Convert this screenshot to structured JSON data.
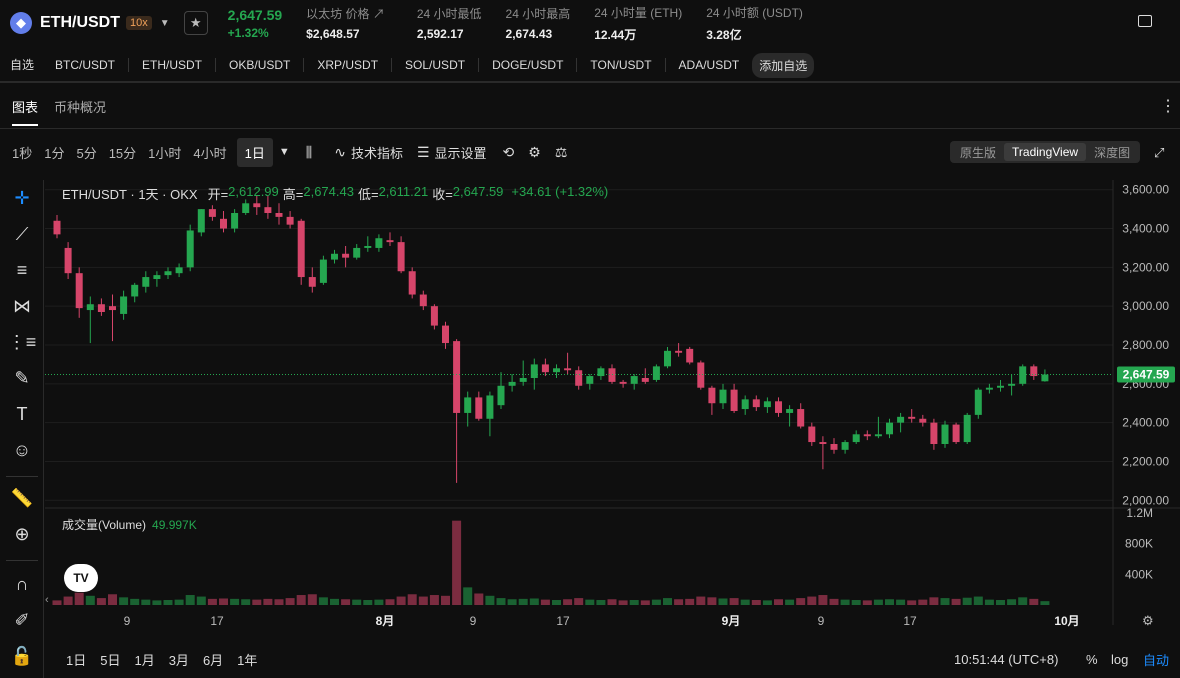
{
  "header": {
    "coin_icon": "eth-icon",
    "pair": "ETH/USDT",
    "leverage": "10x",
    "last_price": "2,647.59",
    "change_pct": "+1.32%",
    "stats": [
      {
        "label": "以太坊 价格 ↗",
        "value": "$2,648.57"
      },
      {
        "label": "24 小时最低",
        "value": "2,592.17"
      },
      {
        "label": "24 小时最高",
        "value": "2,674.43"
      },
      {
        "label": "24 小时量 (ETH)",
        "value": "12.44万"
      },
      {
        "label": "24 小时额 (USDT)",
        "value": "3.28亿"
      }
    ]
  },
  "watchlist": {
    "label": "自选",
    "items": [
      "BTC/USDT",
      "ETH/USDT",
      "OKB/USDT",
      "XRP/USDT",
      "SOL/USDT",
      "DOGE/USDT",
      "TON/USDT",
      "ADA/USDT"
    ],
    "add_label": "添加自选"
  },
  "tabs": [
    "图表",
    "币种概况"
  ],
  "toolbar": {
    "intervals": [
      "1秒",
      "1分",
      "5分",
      "15分",
      "1小时",
      "4小时"
    ],
    "selected_interval": "1日",
    "indicators_label": "技术指标",
    "display_label": "显示设置",
    "views": [
      "原生版",
      "TradingView",
      "深度图"
    ]
  },
  "legend": {
    "title": "ETH/USDT · 1天 · OKX",
    "open_label": "开=",
    "open": "2,612.99",
    "high_label": "高=",
    "high": "2,674.43",
    "low_label": "低=",
    "low": "2,611.21",
    "close_label": "收=",
    "close": "2,647.59",
    "change": "+34.61 (+1.32%)"
  },
  "volume_legend": {
    "label": "成交量(Volume)",
    "value": "49.997K"
  },
  "price_axis": [
    "3,600.00",
    "3,400.00",
    "3,200.00",
    "3,000.00",
    "2,800.00",
    "2,600.00",
    "2,400.00",
    "2,200.00",
    "2,000.00"
  ],
  "last_price_tag": "2,647.59",
  "volume_axis": [
    "1.2M",
    "800K",
    "400K"
  ],
  "time_axis": [
    "9",
    "17",
    "8月",
    "9",
    "17",
    "9月",
    "9",
    "17",
    "10月"
  ],
  "ranges": [
    "1日",
    "5日",
    "1月",
    "3月",
    "6月",
    "1年"
  ],
  "clock": "10:51:44 (UTC+8)",
  "pct_label": "%",
  "log_label": "log",
  "auto_label": "自动",
  "colors": {
    "up": "#25a750",
    "down": "#d6456a",
    "accent": "#1c8cff"
  },
  "chart_data": {
    "type": "candlestick",
    "title": "ETH/USDT · 1天 · OKX",
    "ylim": [
      1950,
      3650
    ],
    "volume_ylim": [
      0,
      1200000
    ],
    "candles": [
      {
        "o": 3440,
        "h": 3470,
        "l": 3350,
        "c": 3370,
        "v": 60000
      },
      {
        "o": 3300,
        "h": 3330,
        "l": 3140,
        "c": 3170,
        "v": 110000
      },
      {
        "o": 3170,
        "h": 3200,
        "l": 2940,
        "c": 2990,
        "v": 160000
      },
      {
        "o": 2980,
        "h": 3050,
        "l": 2810,
        "c": 3010,
        "v": 120000
      },
      {
        "o": 3010,
        "h": 3040,
        "l": 2950,
        "c": 2970,
        "v": 90000
      },
      {
        "o": 3000,
        "h": 3060,
        "l": 2820,
        "c": 2980,
        "v": 140000
      },
      {
        "o": 2960,
        "h": 3080,
        "l": 2930,
        "c": 3050,
        "v": 100000
      },
      {
        "o": 3050,
        "h": 3120,
        "l": 3020,
        "c": 3110,
        "v": 80000
      },
      {
        "o": 3100,
        "h": 3180,
        "l": 3070,
        "c": 3150,
        "v": 70000
      },
      {
        "o": 3140,
        "h": 3180,
        "l": 3100,
        "c": 3160,
        "v": 60000
      },
      {
        "o": 3160,
        "h": 3200,
        "l": 3140,
        "c": 3180,
        "v": 65000
      },
      {
        "o": 3170,
        "h": 3220,
        "l": 3150,
        "c": 3200,
        "v": 70000
      },
      {
        "o": 3200,
        "h": 3420,
        "l": 3180,
        "c": 3390,
        "v": 130000
      },
      {
        "o": 3380,
        "h": 3500,
        "l": 3360,
        "c": 3500,
        "v": 110000
      },
      {
        "o": 3500,
        "h": 3520,
        "l": 3440,
        "c": 3460,
        "v": 80000
      },
      {
        "o": 3450,
        "h": 3490,
        "l": 3380,
        "c": 3400,
        "v": 85000
      },
      {
        "o": 3400,
        "h": 3500,
        "l": 3380,
        "c": 3480,
        "v": 80000
      },
      {
        "o": 3480,
        "h": 3550,
        "l": 3470,
        "c": 3530,
        "v": 75000
      },
      {
        "o": 3530,
        "h": 3570,
        "l": 3470,
        "c": 3510,
        "v": 70000
      },
      {
        "o": 3510,
        "h": 3570,
        "l": 3450,
        "c": 3480,
        "v": 80000
      },
      {
        "o": 3480,
        "h": 3530,
        "l": 3420,
        "c": 3460,
        "v": 75000
      },
      {
        "o": 3460,
        "h": 3490,
        "l": 3400,
        "c": 3420,
        "v": 90000
      },
      {
        "o": 3440,
        "h": 3450,
        "l": 3110,
        "c": 3150,
        "v": 130000
      },
      {
        "o": 3150,
        "h": 3200,
        "l": 3070,
        "c": 3100,
        "v": 140000
      },
      {
        "o": 3120,
        "h": 3260,
        "l": 3110,
        "c": 3240,
        "v": 100000
      },
      {
        "o": 3240,
        "h": 3290,
        "l": 3220,
        "c": 3270,
        "v": 80000
      },
      {
        "o": 3270,
        "h": 3310,
        "l": 3200,
        "c": 3250,
        "v": 75000
      },
      {
        "o": 3250,
        "h": 3320,
        "l": 3240,
        "c": 3300,
        "v": 70000
      },
      {
        "o": 3300,
        "h": 3360,
        "l": 3280,
        "c": 3310,
        "v": 65000
      },
      {
        "o": 3300,
        "h": 3370,
        "l": 3280,
        "c": 3350,
        "v": 70000
      },
      {
        "o": 3340,
        "h": 3380,
        "l": 3310,
        "c": 3330,
        "v": 75000
      },
      {
        "o": 3330,
        "h": 3360,
        "l": 3170,
        "c": 3180,
        "v": 110000
      },
      {
        "o": 3180,
        "h": 3200,
        "l": 3040,
        "c": 3060,
        "v": 140000
      },
      {
        "o": 3060,
        "h": 3080,
        "l": 2980,
        "c": 3000,
        "v": 110000
      },
      {
        "o": 3000,
        "h": 3010,
        "l": 2880,
        "c": 2900,
        "v": 130000
      },
      {
        "o": 2900,
        "h": 2920,
        "l": 2780,
        "c": 2810,
        "v": 120000
      },
      {
        "o": 2820,
        "h": 2830,
        "l": 2090,
        "c": 2450,
        "v": 1100000
      },
      {
        "o": 2450,
        "h": 2560,
        "l": 2380,
        "c": 2530,
        "v": 230000
      },
      {
        "o": 2530,
        "h": 2560,
        "l": 2410,
        "c": 2420,
        "v": 150000
      },
      {
        "o": 2420,
        "h": 2560,
        "l": 2330,
        "c": 2540,
        "v": 120000
      },
      {
        "o": 2490,
        "h": 2660,
        "l": 2470,
        "c": 2590,
        "v": 90000
      },
      {
        "o": 2590,
        "h": 2650,
        "l": 2560,
        "c": 2610,
        "v": 75000
      },
      {
        "o": 2610,
        "h": 2720,
        "l": 2590,
        "c": 2630,
        "v": 80000
      },
      {
        "o": 2630,
        "h": 2730,
        "l": 2570,
        "c": 2700,
        "v": 85000
      },
      {
        "o": 2700,
        "h": 2730,
        "l": 2640,
        "c": 2660,
        "v": 70000
      },
      {
        "o": 2660,
        "h": 2700,
        "l": 2630,
        "c": 2680,
        "v": 65000
      },
      {
        "o": 2680,
        "h": 2760,
        "l": 2650,
        "c": 2670,
        "v": 75000
      },
      {
        "o": 2670,
        "h": 2690,
        "l": 2570,
        "c": 2590,
        "v": 90000
      },
      {
        "o": 2600,
        "h": 2650,
        "l": 2570,
        "c": 2640,
        "v": 70000
      },
      {
        "o": 2640,
        "h": 2690,
        "l": 2620,
        "c": 2680,
        "v": 65000
      },
      {
        "o": 2680,
        "h": 2700,
        "l": 2600,
        "c": 2610,
        "v": 75000
      },
      {
        "o": 2610,
        "h": 2620,
        "l": 2580,
        "c": 2600,
        "v": 60000
      },
      {
        "o": 2600,
        "h": 2650,
        "l": 2570,
        "c": 2640,
        "v": 65000
      },
      {
        "o": 2630,
        "h": 2680,
        "l": 2600,
        "c": 2610,
        "v": 60000
      },
      {
        "o": 2620,
        "h": 2700,
        "l": 2610,
        "c": 2690,
        "v": 70000
      },
      {
        "o": 2690,
        "h": 2790,
        "l": 2680,
        "c": 2770,
        "v": 90000
      },
      {
        "o": 2770,
        "h": 2810,
        "l": 2740,
        "c": 2760,
        "v": 75000
      },
      {
        "o": 2780,
        "h": 2790,
        "l": 2700,
        "c": 2710,
        "v": 80000
      },
      {
        "o": 2710,
        "h": 2720,
        "l": 2570,
        "c": 2580,
        "v": 110000
      },
      {
        "o": 2580,
        "h": 2590,
        "l": 2440,
        "c": 2500,
        "v": 100000
      },
      {
        "o": 2500,
        "h": 2600,
        "l": 2470,
        "c": 2570,
        "v": 85000
      },
      {
        "o": 2570,
        "h": 2600,
        "l": 2450,
        "c": 2460,
        "v": 90000
      },
      {
        "o": 2470,
        "h": 2540,
        "l": 2440,
        "c": 2520,
        "v": 70000
      },
      {
        "o": 2520,
        "h": 2540,
        "l": 2460,
        "c": 2480,
        "v": 65000
      },
      {
        "o": 2480,
        "h": 2530,
        "l": 2450,
        "c": 2510,
        "v": 60000
      },
      {
        "o": 2510,
        "h": 2530,
        "l": 2430,
        "c": 2450,
        "v": 75000
      },
      {
        "o": 2450,
        "h": 2490,
        "l": 2380,
        "c": 2470,
        "v": 70000
      },
      {
        "o": 2470,
        "h": 2500,
        "l": 2370,
        "c": 2380,
        "v": 90000
      },
      {
        "o": 2380,
        "h": 2400,
        "l": 2280,
        "c": 2300,
        "v": 110000
      },
      {
        "o": 2300,
        "h": 2330,
        "l": 2160,
        "c": 2290,
        "v": 130000
      },
      {
        "o": 2290,
        "h": 2320,
        "l": 2240,
        "c": 2260,
        "v": 80000
      },
      {
        "o": 2260,
        "h": 2310,
        "l": 2240,
        "c": 2300,
        "v": 70000
      },
      {
        "o": 2300,
        "h": 2360,
        "l": 2290,
        "c": 2340,
        "v": 65000
      },
      {
        "o": 2340,
        "h": 2360,
        "l": 2310,
        "c": 2330,
        "v": 60000
      },
      {
        "o": 2330,
        "h": 2430,
        "l": 2320,
        "c": 2340,
        "v": 70000
      },
      {
        "o": 2340,
        "h": 2420,
        "l": 2320,
        "c": 2400,
        "v": 75000
      },
      {
        "o": 2400,
        "h": 2450,
        "l": 2350,
        "c": 2430,
        "v": 70000
      },
      {
        "o": 2430,
        "h": 2470,
        "l": 2400,
        "c": 2420,
        "v": 60000
      },
      {
        "o": 2420,
        "h": 2440,
        "l": 2380,
        "c": 2400,
        "v": 70000
      },
      {
        "o": 2400,
        "h": 2420,
        "l": 2260,
        "c": 2290,
        "v": 100000
      },
      {
        "o": 2290,
        "h": 2410,
        "l": 2270,
        "c": 2390,
        "v": 90000
      },
      {
        "o": 2390,
        "h": 2400,
        "l": 2290,
        "c": 2300,
        "v": 80000
      },
      {
        "o": 2300,
        "h": 2450,
        "l": 2290,
        "c": 2440,
        "v": 95000
      },
      {
        "o": 2440,
        "h": 2580,
        "l": 2420,
        "c": 2570,
        "v": 110000
      },
      {
        "o": 2570,
        "h": 2600,
        "l": 2550,
        "c": 2580,
        "v": 70000
      },
      {
        "o": 2580,
        "h": 2620,
        "l": 2560,
        "c": 2590,
        "v": 65000
      },
      {
        "o": 2590,
        "h": 2650,
        "l": 2540,
        "c": 2600,
        "v": 75000
      },
      {
        "o": 2600,
        "h": 2700,
        "l": 2590,
        "c": 2690,
        "v": 100000
      },
      {
        "o": 2690,
        "h": 2700,
        "l": 2620,
        "c": 2640,
        "v": 80000
      },
      {
        "o": 2613,
        "h": 2674,
        "l": 2611,
        "c": 2648,
        "v": 50000
      }
    ]
  }
}
